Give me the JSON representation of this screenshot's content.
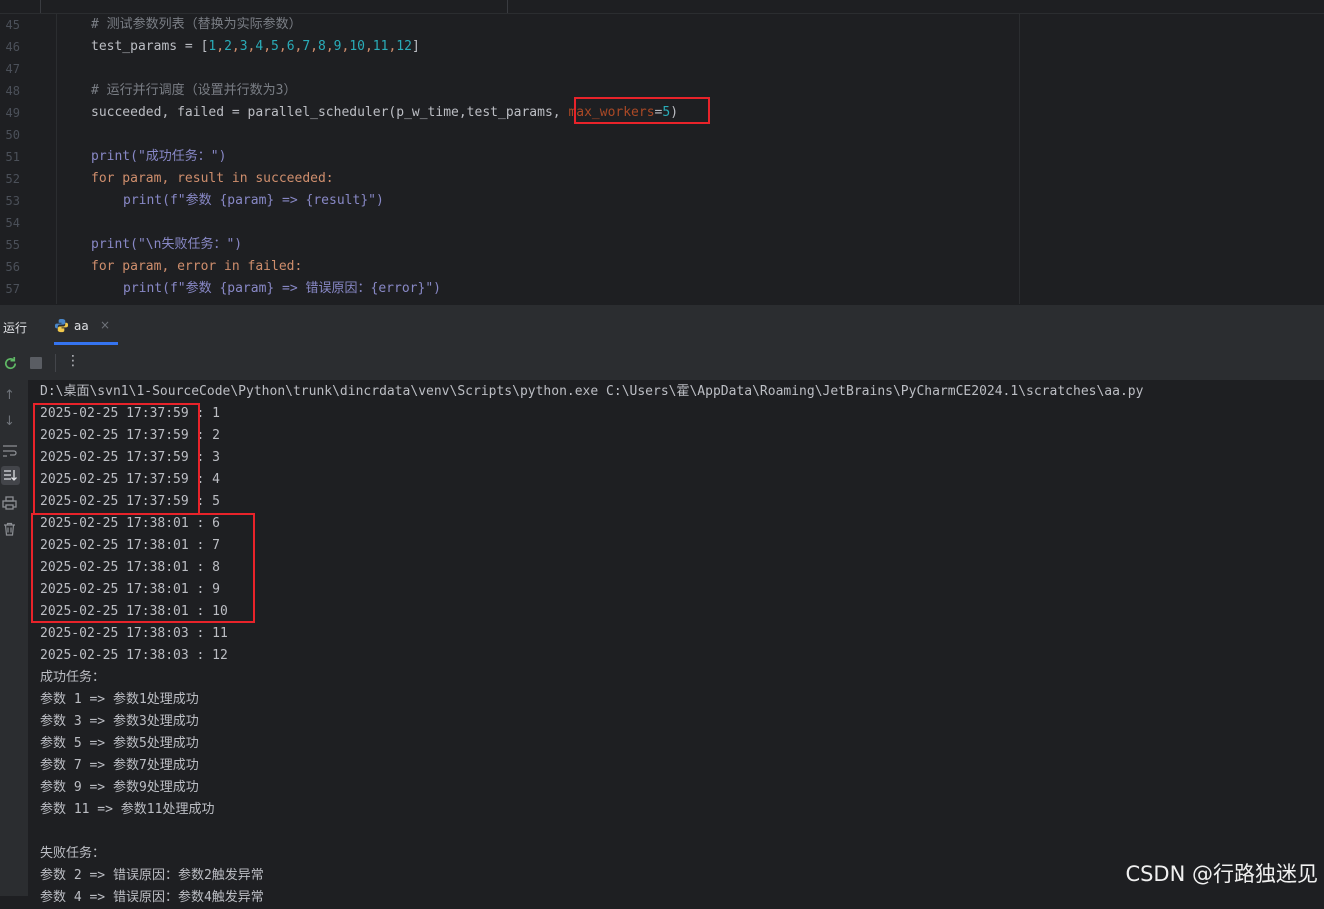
{
  "editor": {
    "line_numbers": [
      "45",
      "46",
      "47",
      "48",
      "49",
      "50",
      "51",
      "52",
      "53",
      "54",
      "55",
      "56",
      "57"
    ],
    "comment_params": "# 测试参数列表（替换为实际参数）",
    "params_var": "test_params = [",
    "params_values": [
      "1",
      "2",
      "3",
      "4",
      "5",
      "6",
      "7",
      "8",
      "9",
      "10",
      "11",
      "12"
    ],
    "params_close": "]",
    "comment_run": "# 运行并行调度（设置并行数为3）",
    "scheduler_call": "succeeded, failed = parallel_scheduler(p_w_time,test_params, ",
    "max_workers_param": "max_workers",
    "max_workers_eq": "=",
    "max_workers_value": "5",
    "scheduler_close": ")",
    "print_success": "print(\"成功任务：\")",
    "for_success": "for param, result in succeeded:",
    "print_success_item": "print(f\"参数 {param} => {result}\")",
    "print_failed": "print(\"\\n失败任务：\")",
    "for_failed": "for param, error in failed:",
    "print_failed_item": "print(f\"参数 {param} => 错误原因：{error}\")"
  },
  "run_panel": {
    "title": "运行",
    "tab_label": "aa",
    "tab_close": "×"
  },
  "console": {
    "command": "D:\\桌面\\svn1\\1-SourceCode\\Python\\trunk\\dincrdata\\venv\\Scripts\\python.exe C:\\Users\\霍\\AppData\\Roaming\\JetBrains\\PyCharmCE2024.1\\scratches\\aa.py",
    "lines": [
      "2025-02-25 17:37:59 : 1",
      "2025-02-25 17:37:59 : 2",
      "2025-02-25 17:37:59 : 3",
      "2025-02-25 17:37:59 : 4",
      "2025-02-25 17:37:59 : 5",
      "2025-02-25 17:38:01 : 6",
      "2025-02-25 17:38:01 : 7",
      "2025-02-25 17:38:01 : 8",
      "2025-02-25 17:38:01 : 9",
      "2025-02-25 17:38:01 : 10",
      "2025-02-25 17:38:03 : 11",
      "2025-02-25 17:38:03 : 12",
      "成功任务：",
      "参数 1 => 参数1处理成功",
      "参数 3 => 参数3处理成功",
      "参数 5 => 参数5处理成功",
      "参数 7 => 参数7处理成功",
      "参数 9 => 参数9处理成功",
      "参数 11 => 参数11处理成功",
      "",
      "失败任务：",
      "参数 2 => 错误原因：参数2触发异常",
      "参数 4 => 错误原因：参数4触发异常"
    ]
  },
  "icons": {
    "rerun": "rerun-icon",
    "stop": "stop-icon",
    "more": "more-options-icon",
    "scroll_up": "arrow-up-icon",
    "scroll_down": "arrow-down-icon",
    "soft_wrap": "soft-wrap-icon",
    "scroll_to_end": "scroll-to-end-icon",
    "print": "print-icon",
    "clear": "trash-icon"
  },
  "highlight_color": "#e8232a",
  "watermark": "CSDN @行路独迷见"
}
